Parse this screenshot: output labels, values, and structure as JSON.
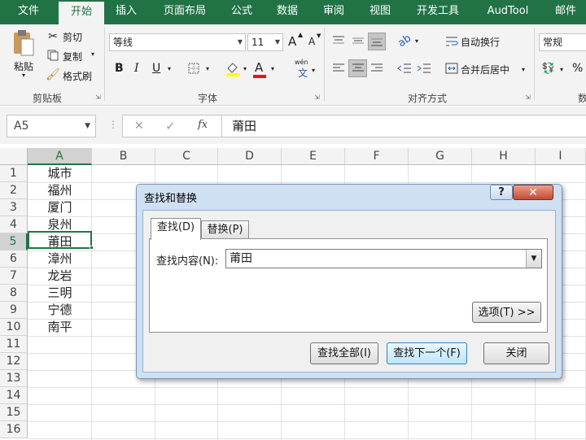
{
  "ribbon_tabs": [
    "文件",
    "开始",
    "插入",
    "页面布局",
    "公式",
    "数据",
    "审阅",
    "视图",
    "开发工具",
    "AudTool",
    "邮件"
  ],
  "clipboard": {
    "paste": "粘贴",
    "cut": "剪切",
    "copy": "复制",
    "format_painter": "格式刷",
    "label": "剪贴板"
  },
  "font": {
    "name": "等线",
    "size": "11",
    "grow": "A",
    "shrink": "A",
    "bold": "B",
    "italic": "I",
    "underline": "U",
    "font_color_glyph": "A",
    "phonetic": "wén",
    "phonetic_char": "文",
    "label": "字体"
  },
  "alignment": {
    "wrap": "自动换行",
    "merge": "合并后居中",
    "label": "对齐方式"
  },
  "number": {
    "format": "常规",
    "percent": "%",
    "label": "数"
  },
  "formula_bar": {
    "name_box": "A5",
    "cancel": "✕",
    "enter": "✓",
    "fx": "fx",
    "value": "莆田"
  },
  "columns": [
    "A",
    "B",
    "C",
    "D",
    "E",
    "F",
    "G",
    "H",
    "I"
  ],
  "rows": [
    "1",
    "2",
    "3",
    "4",
    "5",
    "6",
    "7",
    "8",
    "9",
    "10",
    "11",
    "12",
    "13",
    "14",
    "15",
    "16"
  ],
  "cells_a": [
    "城市",
    "福州",
    "厦门",
    "泉州",
    "莆田",
    "漳州",
    "龙岩",
    "三明",
    "宁德",
    "南平"
  ],
  "selected_cell": "A5",
  "dialog": {
    "title": "查找和替换",
    "help": "?",
    "close": "✕",
    "tab_find": "查找(D)",
    "tab_replace": "替换(P)",
    "find_label": "查找内容(N):",
    "find_value": "莆田",
    "options_button": "选项(T) >>",
    "find_all_button": "查找全部(I)",
    "find_next_button": "查找下一个(F)",
    "close_button": "关闭"
  },
  "colors": {
    "brand_green": "#217346",
    "dialog_frame": "#cfe0f3",
    "close_red": "#c64a34"
  }
}
